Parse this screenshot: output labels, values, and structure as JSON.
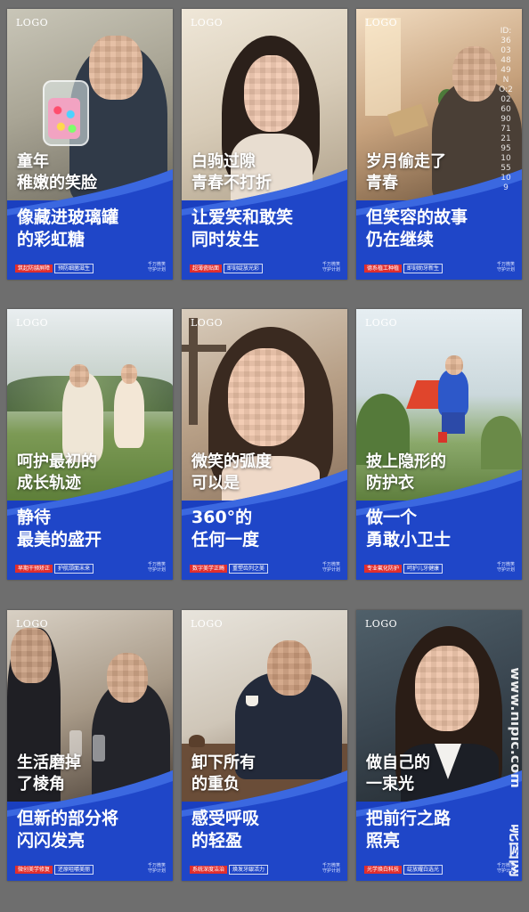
{
  "cards": [
    {
      "logo": "LOGO",
      "line1": "童年",
      "line2": "稚嫩的笑脸",
      "line3": "像藏进玻璃罐",
      "line4": "的彩虹糖",
      "tag1": "筑起防龋屏障",
      "tag2": "预防细菌滋生",
      "brand1": "千万微笑",
      "brand2": "守护计划"
    },
    {
      "logo": "LOGO",
      "line1": "白驹过隙",
      "line2": "青春不打折",
      "line3": "让爱笑和敢笑",
      "line4": "同时发生",
      "tag1": "超薄瓷贴面",
      "tag2": "即刻绽放光彩",
      "brand1": "千万微笑",
      "brand2": "守护计划"
    },
    {
      "logo": "LOGO",
      "line1": "岁月偷走了",
      "line2": "青春",
      "line3": "但笑容的故事",
      "line4": "仍在继续",
      "tag1": "德系植工种植",
      "tag2": "即刻助牙新生",
      "brand1": "千万微笑",
      "brand2": "守护计划"
    },
    {
      "logo": "LOGO",
      "line1": "呵护最初的",
      "line2": "成长轨迹",
      "line3": "静待",
      "line4": "最美的盛开",
      "tag1": "早期干预矫正",
      "tag2": "护航颌面未来",
      "brand1": "千万微笑",
      "brand2": "守护计划"
    },
    {
      "logo": "LOGO",
      "line1": "微笑的弧度",
      "line2": "可以是",
      "line3": "360°的",
      "line4": "任何一度",
      "tag1": "数字美学正畸",
      "tag2": "重塑齿列之美",
      "brand1": "千万微笑",
      "brand2": "守护计划"
    },
    {
      "logo": "LOGO",
      "line1": "披上隐形的",
      "line2": "防护衣",
      "line3": "做一个",
      "line4": "勇敢小卫士",
      "tag1": "专业氟化防护",
      "tag2": "呵护儿牙健康",
      "brand1": "千万微笑",
      "brand2": "守护计划"
    },
    {
      "logo": "LOGO",
      "line1": "生活磨掉",
      "line2": "了棱角",
      "line3": "但新的部分将",
      "line4": "闪闪发亮",
      "tag1": "微创美学修复",
      "tag2": "还原咀嚼美丽",
      "brand1": "千万微笑",
      "brand2": "守护计划"
    },
    {
      "logo": "LOGO",
      "line1": "卸下所有",
      "line2": "的重负",
      "line3": "感受呼吸",
      "line4": "的轻盈",
      "tag1": "系统深度洁治",
      "tag2": "焕发牙龈活力",
      "brand1": "千万微笑",
      "brand2": "守护计划"
    },
    {
      "logo": "LOGO",
      "line1": "做自己的",
      "line2": "一束光",
      "line3": "把前行之路",
      "line4": "照亮",
      "tag1": "光学焕白科技",
      "tag2": "绽放耀白选光",
      "brand1": "千万微笑",
      "brand2": "守护计划"
    }
  ],
  "watermark_id": "ID:36034849 NO:20260907121951055109",
  "watermark_site": "www.nipic.com",
  "watermark_brand": "昵图网"
}
